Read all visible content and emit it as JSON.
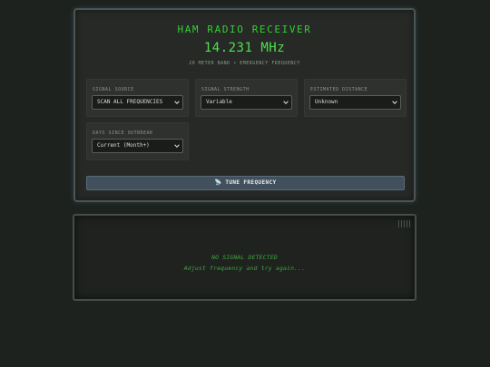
{
  "receiver": {
    "title": "HAM RADIO RECEIVER",
    "frequency": "14.231 MHz",
    "subtitle": "20 METER BAND • EMERGENCY FREQUENCY"
  },
  "controls": {
    "signal_source": {
      "label": "SIGNAL SOURCE",
      "value": "SCAN ALL FREQUENCIES"
    },
    "signal_strength": {
      "label": "SIGNAL STRENGTH",
      "value": "Variable"
    },
    "estimated_distance": {
      "label": "ESTIMATED DISTANCE",
      "value": "Unknown"
    },
    "days_since_outbreak": {
      "label": "DAYS SINCE OUTBREAK",
      "value": "Current (Month+)"
    }
  },
  "tune_button": {
    "icon": "satellite-antenna-icon",
    "label": "TUNE FREQUENCY"
  },
  "output": {
    "line1": "NO SIGNAL DETECTED",
    "line2": "Adjust frequency and try again..."
  },
  "colors": {
    "accent_green": "#35cf35",
    "button": "#42505e",
    "background": "#1e221e"
  }
}
